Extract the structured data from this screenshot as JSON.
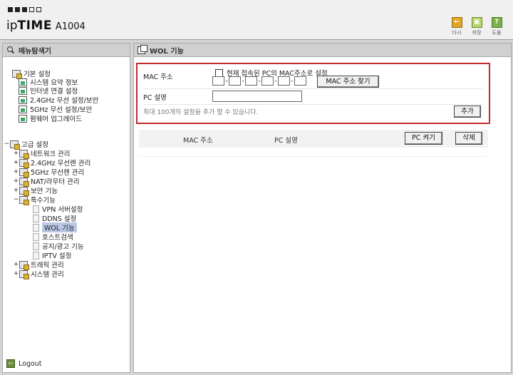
{
  "header": {
    "logo_ip": "ip",
    "logo_time": "TIME",
    "logo_model": "A1004",
    "tools": [
      {
        "label": "다시",
        "icon": "refresh-icon",
        "glyph": "←"
      },
      {
        "label": "저장",
        "icon": "save-icon",
        "glyph": "▣"
      },
      {
        "label": "도움",
        "icon": "help-icon",
        "glyph": "?"
      }
    ]
  },
  "sidebar": {
    "title": "메뉴탐색기",
    "basic": {
      "label": "기본 설정",
      "items": [
        "시스템 요약 정보",
        "인터넷 연결 설정",
        "2.4GHz 무선 설정/보안",
        "5GHz 무선 설정/보안",
        "펌웨어 업그레이드"
      ]
    },
    "advanced": {
      "label": "고급 설정",
      "groups": [
        "네트워크 관리",
        "2.4GHz 무선랜 관리",
        "5GHz 무선랜 관리",
        "NAT/라우터 관리",
        "보안 기능",
        "특수기능"
      ],
      "special_items": [
        "VPN 서버설정",
        "DDNS 설정",
        "WOL 기능",
        "호스트검색",
        "공지/광고 기능",
        "IPTV 설정"
      ],
      "selected": "WOL 기능",
      "after": [
        "트래픽 관리",
        "시스템 관리"
      ]
    },
    "logout": "Logout"
  },
  "main": {
    "title": "WOL 기능",
    "form": {
      "mac_label": "MAC 주소",
      "checkbox_label": "현재 접속된 PC의 MAC주소로 설정",
      "find_mac_button": "MAC 주소 찾기",
      "pc_label": "PC 설명",
      "pc_value": "",
      "note": "최대 100개의 설정을 추가 할 수 있습니다.",
      "add_button": "추가"
    },
    "list": {
      "col_mac": "MAC 주소",
      "col_pc": "PC 설명",
      "wake_button": "PC 켜기",
      "delete_button": "삭제"
    }
  }
}
